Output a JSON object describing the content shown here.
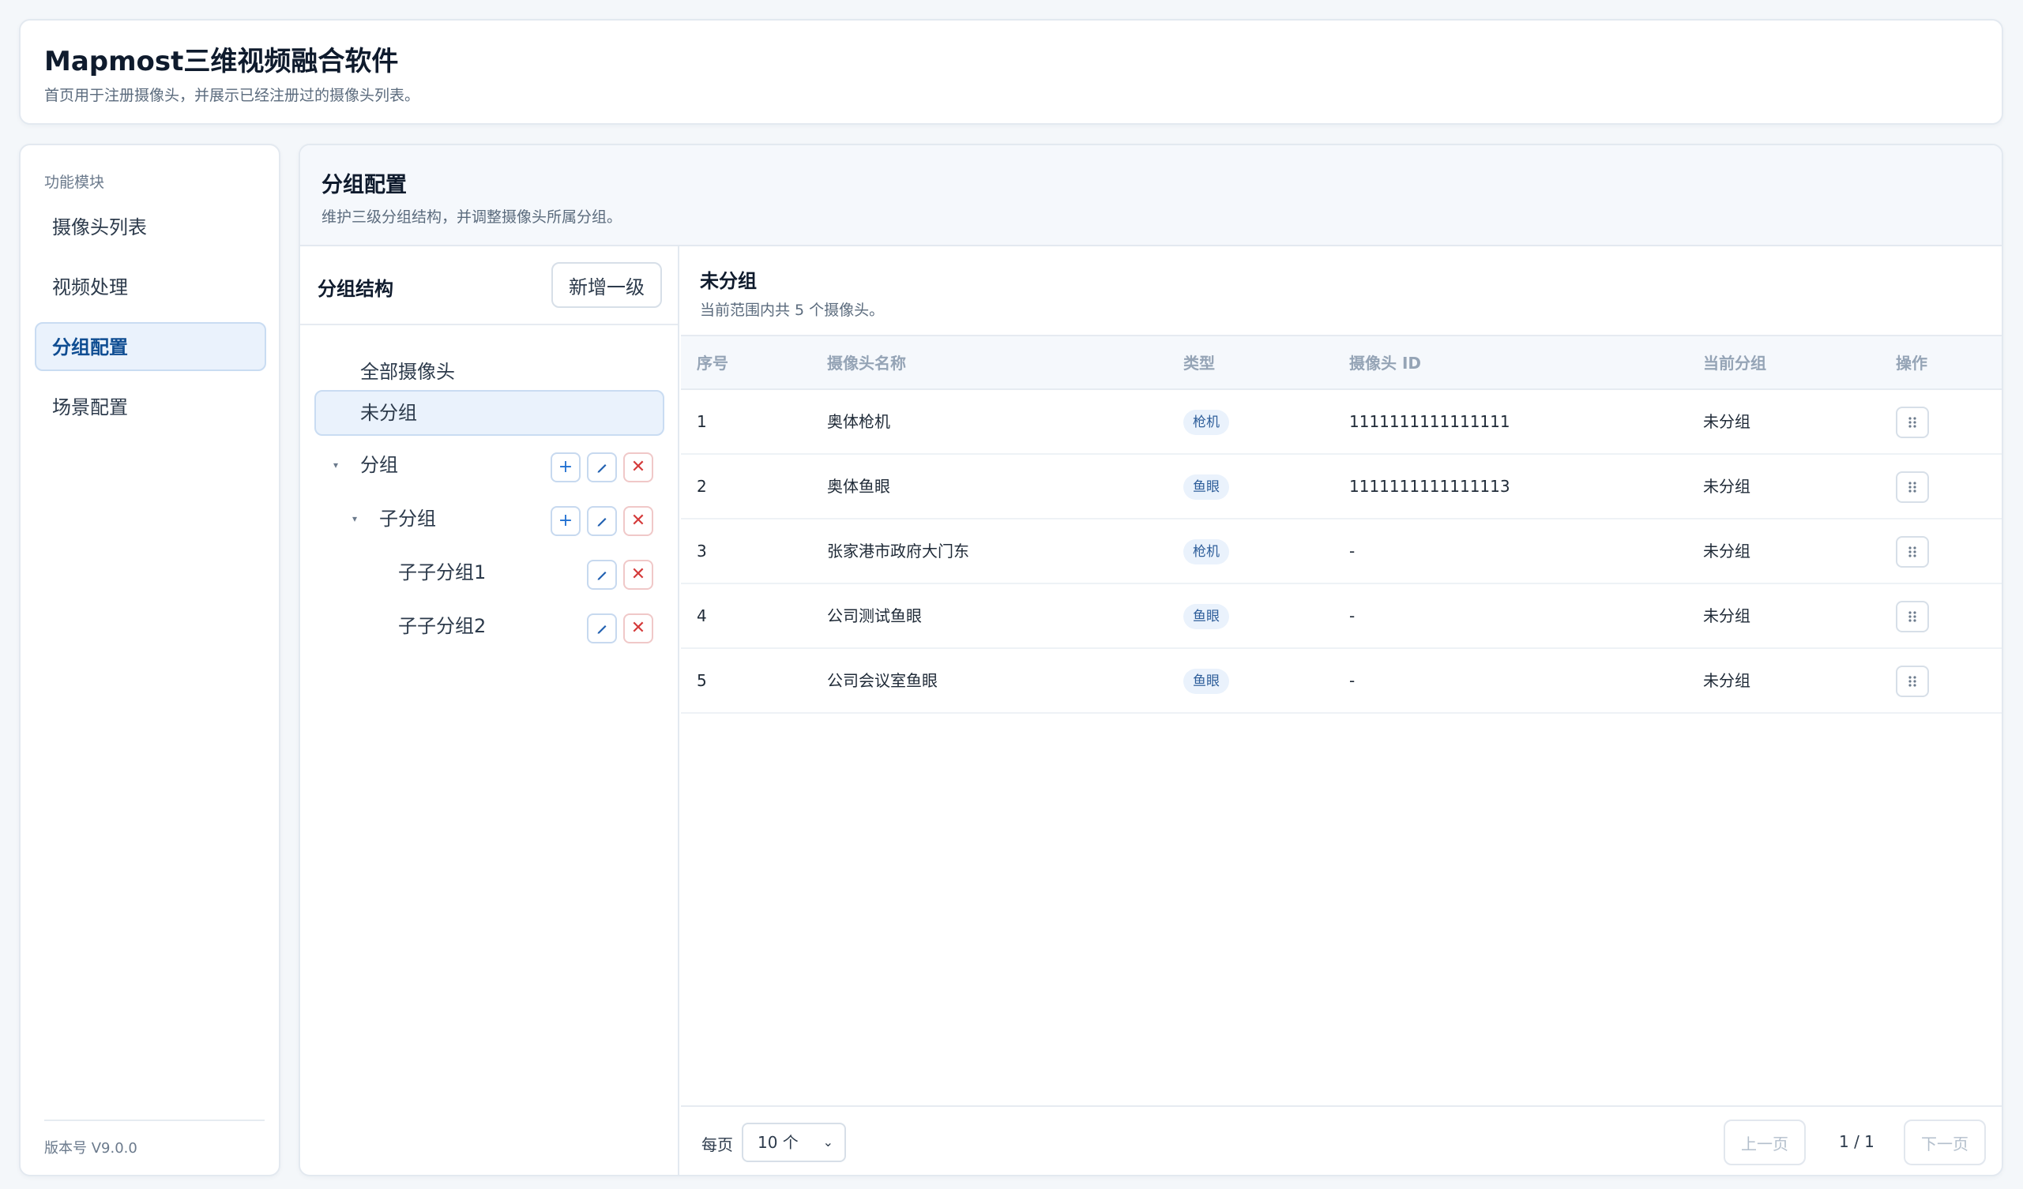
{
  "header": {
    "title": "Mapmost三维视频融合软件",
    "subtitle": "首页用于注册摄像头，并展示已经注册过的摄像头列表。"
  },
  "sidebar": {
    "section_label": "功能模块",
    "items": [
      {
        "label": "摄像头列表",
        "active": false
      },
      {
        "label": "视频处理",
        "active": false
      },
      {
        "label": "分组配置",
        "active": true
      },
      {
        "label": "场景配置",
        "active": false
      }
    ],
    "version": "版本号 V9.0.0"
  },
  "main": {
    "title": "分组配置",
    "subtitle": "维护三级分组结构，并调整摄像头所属分组。"
  },
  "tree": {
    "title": "分组结构",
    "add_root_label": "新增一级",
    "nodes": [
      {
        "label": "全部摄像头"
      },
      {
        "label": "未分组",
        "selected": true
      },
      {
        "label": "分组"
      },
      {
        "label": "子分组"
      },
      {
        "label": "子子分组1"
      },
      {
        "label": "子子分组2"
      }
    ],
    "icons": {
      "add": "plus-icon",
      "edit": "pencil-icon",
      "delete": "close-icon",
      "expand": "caret-down-icon"
    }
  },
  "content": {
    "title": "未分组",
    "subtitle": "当前范围内共 5 个摄像头。",
    "columns": [
      "序号",
      "摄像头名称",
      "类型",
      "摄像头 ID",
      "当前分组",
      "操作"
    ],
    "rows": [
      {
        "index": "1",
        "name": "奥体枪机",
        "type": "枪机",
        "id": "1111111111111111",
        "group": "未分组"
      },
      {
        "index": "2",
        "name": "奥体鱼眼",
        "type": "鱼眼",
        "id": "1111111111111113",
        "group": "未分组"
      },
      {
        "index": "3",
        "name": "张家港市政府大门东",
        "type": "枪机",
        "id": "-",
        "group": "未分组"
      },
      {
        "index": "4",
        "name": "公司测试鱼眼",
        "type": "鱼眼",
        "id": "-",
        "group": "未分组"
      },
      {
        "index": "5",
        "name": "公司会议室鱼眼",
        "type": "鱼眼",
        "id": "-",
        "group": "未分组"
      }
    ]
  },
  "pager": {
    "per_page_label": "每页",
    "per_page_value": "10 个",
    "prev_label": "上一页",
    "page_info": "1 / 1",
    "next_label": "下一页"
  },
  "colors": {
    "accent": "#1f6fd1",
    "active_bg": "#eaf2fc",
    "danger": "#d43a3a",
    "page_bg": "#f4f7fa"
  }
}
